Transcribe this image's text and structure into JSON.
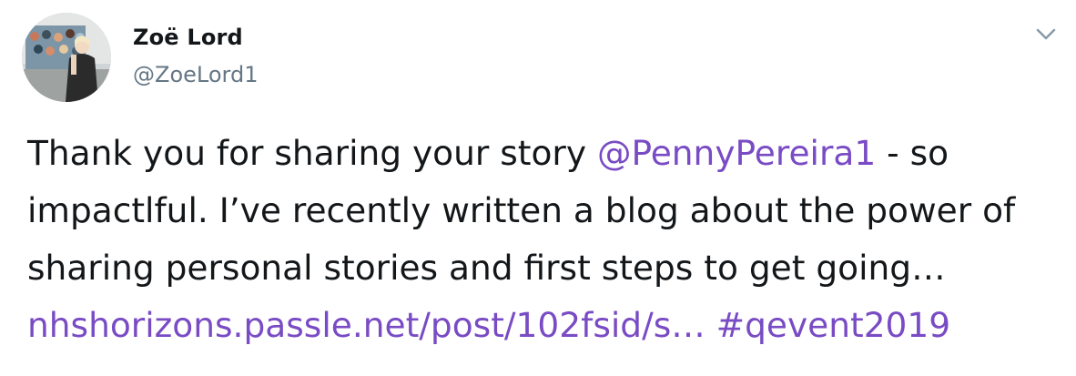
{
  "author": {
    "display_name": "Zoë Lord",
    "handle": "@ZoeLord1"
  },
  "tweet": {
    "text_1": "Thank you for sharing your story ",
    "mention": "@PennyPereira1",
    "text_2": " - so impactlful. I’ve recently written a blog about the power of sharing personal stories and first steps to get going…",
    "link": "nhshorizons.passle.net/post/102fsid/s…",
    "space": " ",
    "hashtag": "#qevent2019"
  },
  "icons": {
    "menu": "chevron-down-icon",
    "avatar": "avatar"
  },
  "colors": {
    "text": "#14171a",
    "secondary": "#657786",
    "link": "#794bc4",
    "background": "#ffffff"
  }
}
